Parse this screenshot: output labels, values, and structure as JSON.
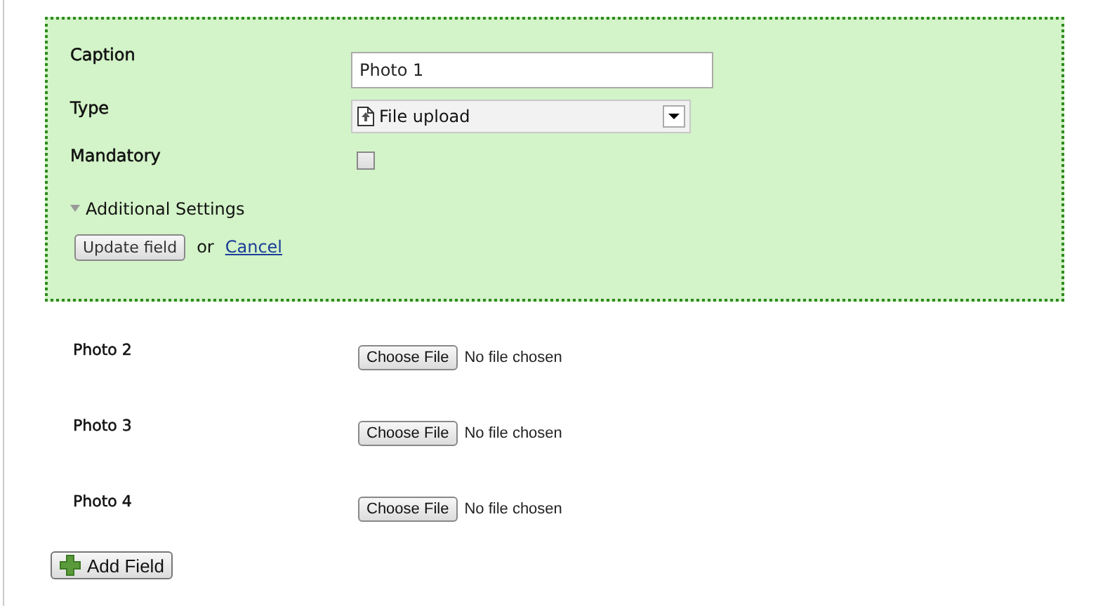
{
  "edit_panel": {
    "caption": {
      "label": "Caption",
      "value": "Photo 1"
    },
    "type": {
      "label": "Type",
      "value": "File upload"
    },
    "mandatory": {
      "label": "Mandatory",
      "checked": false
    },
    "additional_settings": {
      "label": "Additional Settings",
      "expanded": true
    },
    "update_button": "Update field",
    "separator": "or",
    "cancel_link": "Cancel"
  },
  "file_fields": [
    {
      "label": "Photo 2",
      "button": "Choose File",
      "status": "No file chosen"
    },
    {
      "label": "Photo 3",
      "button": "Choose File",
      "status": "No file chosen"
    },
    {
      "label": "Photo 4",
      "button": "Choose File",
      "status": "No file chosen"
    }
  ],
  "add_button": "Add Field"
}
